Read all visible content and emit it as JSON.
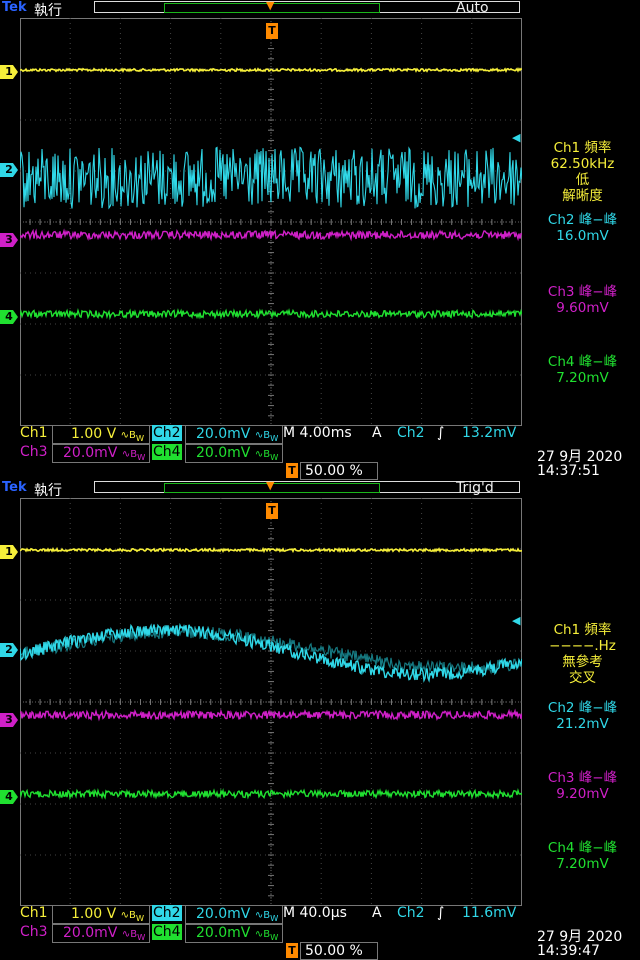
{
  "logo": "Tek",
  "colors": {
    "ch1": "#f6ef3a",
    "ch2": "#30d8e8",
    "ch2_persist": "#167a82",
    "ch3": "#d020c8",
    "ch4": "#20e030",
    "trigger": "#ff8a00",
    "grid": "#444"
  },
  "screens": [
    {
      "run_state": "執行",
      "trigger_status": "Auto",
      "meas": {
        "ch1_label": "Ch1 頻率",
        "ch1_value": "62.50kHz",
        "ch1_note1": "低",
        "ch1_note2": "解晰度",
        "ch2_label": "Ch2 峰−峰",
        "ch2_value": "16.0mV",
        "ch3_label": "Ch3 峰−峰",
        "ch3_value": "9.60mV",
        "ch4_label": "Ch4 峰−峰",
        "ch4_value": "7.20mV"
      },
      "status": {
        "ch1": "Ch1",
        "ch1_scale": "1.00 V",
        "ch2": "Ch2",
        "ch2_scale": "20.0mV",
        "ch3": "Ch3",
        "ch3_scale": "20.0mV",
        "ch4": "Ch4",
        "ch4_scale": "20.0mV",
        "bw_mark": "∿B<sub>W</sub>",
        "timebase": "M 4.00ms",
        "trig_mode": "A",
        "trig_source": "Ch2",
        "trig_slope": "∫",
        "trig_level": "13.2mV",
        "position": "50.00 %",
        "date": "27 9月  2020",
        "time": "14:37:51"
      },
      "waveform": {
        "ch2_shape": "noise",
        "ch2_noise_pp_div": 1.2
      }
    },
    {
      "run_state": "執行",
      "trigger_status": "Trig'd",
      "meas": {
        "ch1_label": "Ch1 頻率",
        "ch1_value": "−−−−.Hz",
        "ch1_note1": "無參考",
        "ch1_note2": "交叉",
        "ch2_label": "Ch2 峰−峰",
        "ch2_value": "21.2mV",
        "ch3_label": "Ch3 峰−峰",
        "ch3_value": "9.20mV",
        "ch4_label": "Ch4 峰−峰",
        "ch4_value": "7.20mV"
      },
      "status": {
        "ch1": "Ch1",
        "ch1_scale": "1.00 V",
        "ch2": "Ch2",
        "ch2_scale": "20.0mV",
        "ch3": "Ch3",
        "ch3_scale": "20.0mV",
        "ch4": "Ch4",
        "ch4_scale": "20.0mV",
        "bw_mark": "∿B<sub>W</sub>",
        "timebase": "M 40.0µs",
        "trig_mode": "A",
        "trig_source": "Ch2",
        "trig_slope": "∫",
        "trig_level": "11.6mV",
        "position": "50.00 %",
        "date": "27 9月  2020",
        "time": "14:39:47"
      },
      "waveform": {
        "ch2_shape": "sine",
        "ch2_noise_pp_div": 0.25
      }
    }
  ]
}
